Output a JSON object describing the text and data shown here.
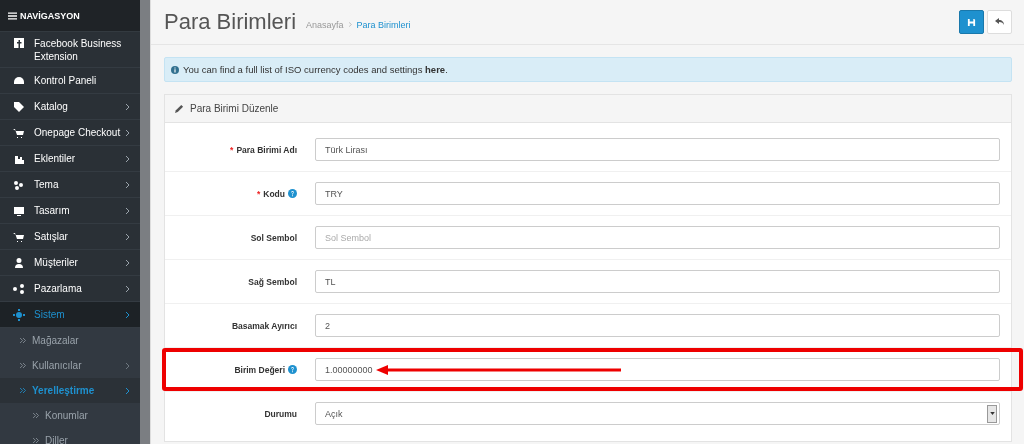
{
  "sidebar": {
    "heading": "NAVİGASYON",
    "items": [
      {
        "label": "Facebook Business Extension",
        "selected": false,
        "submenu": false
      },
      {
        "label": "Kontrol Paneli",
        "selected": false,
        "submenu": false
      },
      {
        "label": "Katalog",
        "selected": false,
        "submenu": true
      },
      {
        "label": "Onepage Checkout",
        "selected": false,
        "submenu": true
      },
      {
        "label": "Eklentiler",
        "selected": false,
        "submenu": true
      },
      {
        "label": "Tema",
        "selected": false,
        "submenu": true
      },
      {
        "label": "Tasarım",
        "selected": false,
        "submenu": true
      },
      {
        "label": "Satışlar",
        "selected": false,
        "submenu": true
      },
      {
        "label": "Müşteriler",
        "selected": false,
        "submenu": true
      },
      {
        "label": "Pazarlama",
        "selected": false,
        "submenu": true
      },
      {
        "label": "Sistem",
        "selected": true,
        "submenu": true,
        "children": [
          {
            "label": "Mağazalar",
            "selected": false,
            "submenu": false
          },
          {
            "label": "Kullanıcılar",
            "selected": false,
            "submenu": true
          },
          {
            "label": "Yerelleştirme",
            "selected": true,
            "submenu": true,
            "children": [
              {
                "label": "Konumlar",
                "selected": false
              },
              {
                "label": "Diller",
                "selected": false
              }
            ]
          }
        ]
      }
    ]
  },
  "page": {
    "title": "Para Birimleri",
    "breadcrumb": [
      {
        "label": "Anasayfa",
        "selected": false
      },
      {
        "label": "Para Birimleri",
        "selected": true
      }
    ]
  },
  "alert": {
    "text": "You can find a full list of ISO currency codes and settings **here**."
  },
  "panel": {
    "title": "Para Birimi Düzenle",
    "fields": [
      {
        "kind": "text",
        "label": "Para Birimi Adı",
        "required_marker": "*",
        "help": false,
        "value": "Türk Lirası",
        "highlighted": false
      },
      {
        "kind": "text",
        "label": "Kodu",
        "required_marker": "*",
        "help": true,
        "value": "TRY",
        "highlighted": false
      },
      {
        "kind": "text",
        "label": "Sol Sembol",
        "help": false,
        "placeholder": "Sol Sembol",
        "highlighted": false
      },
      {
        "kind": "text",
        "label": "Sağ Sembol",
        "help": false,
        "value": "TL",
        "highlighted": false
      },
      {
        "kind": "text",
        "label": "Basamak Ayırıcı",
        "help": false,
        "value": "2",
        "highlighted": false
      },
      {
        "kind": "text",
        "label": "Birim Değeri",
        "help": true,
        "value": "1.00000000",
        "highlighted": true
      },
      {
        "kind": "select",
        "label": "Durumu",
        "help": false,
        "value": "Açık",
        "highlighted": false
      }
    ]
  }
}
